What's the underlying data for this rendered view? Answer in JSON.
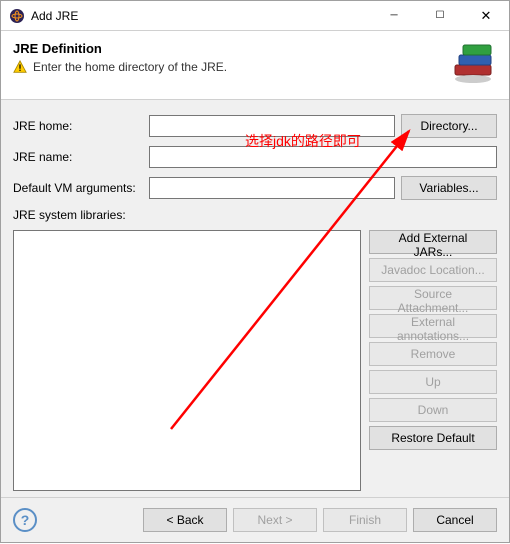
{
  "window": {
    "title": "Add JRE"
  },
  "header": {
    "title": "JRE Definition",
    "message": "Enter the home directory of the JRE."
  },
  "form": {
    "jre_home_label": "JRE home:",
    "jre_home_value": "",
    "jre_name_label": "JRE name:",
    "jre_name_value": "",
    "vm_args_label": "Default VM arguments:",
    "vm_args_value": "",
    "libs_label": "JRE system libraries:"
  },
  "buttons": {
    "directory": "Directory...",
    "variables": "Variables...",
    "add_jars": "Add External JARs...",
    "javadoc": "Javadoc Location...",
    "source": "Source Attachment...",
    "ext_anno": "External annotations...",
    "remove": "Remove",
    "up": "Up",
    "down": "Down",
    "restore": "Restore Default",
    "back": "< Back",
    "next": "Next >",
    "finish": "Finish",
    "cancel": "Cancel",
    "help": "?"
  },
  "annotation": {
    "text": "选择jdk的路径即可"
  }
}
